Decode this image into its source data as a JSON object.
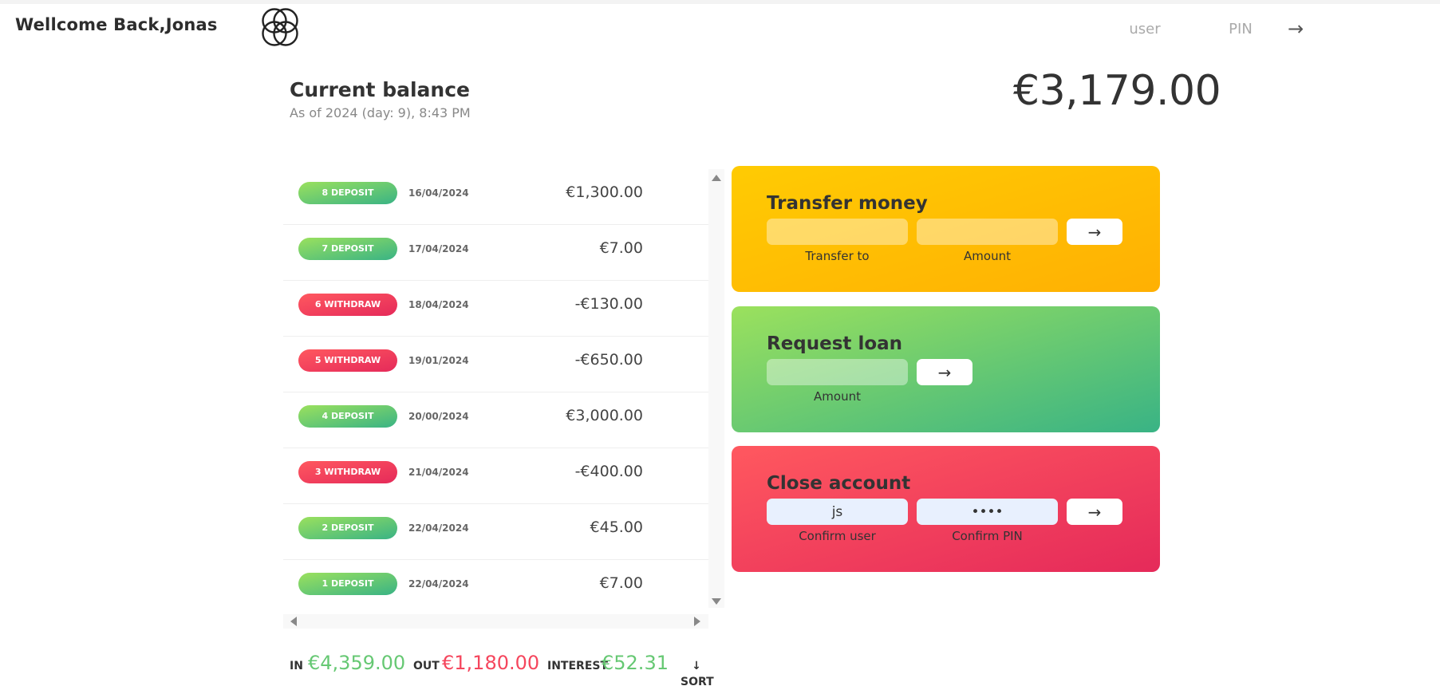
{
  "nav": {
    "welcome": "Wellcome Back,Jonas",
    "user_placeholder": "user",
    "pin_placeholder": "PIN",
    "login_arrow": "→"
  },
  "balance": {
    "label": "Current balance",
    "date": "As of 2024 (day: 9), 8:43 PM",
    "value": "€3,179.00"
  },
  "movements": [
    {
      "type_label": "8 DEPOSIT",
      "kind": "deposit",
      "date": "16/04/2024",
      "value": "€1,300.00"
    },
    {
      "type_label": "7 DEPOSIT",
      "kind": "deposit",
      "date": "17/04/2024",
      "value": "€7.00"
    },
    {
      "type_label": "6 WITHDRAW",
      "kind": "withdrawal",
      "date": "18/04/2024",
      "value": "-€130.00"
    },
    {
      "type_label": "5 WITHDRAW",
      "kind": "withdrawal",
      "date": "19/01/2024",
      "value": "-€650.00"
    },
    {
      "type_label": "4 DEPOSIT",
      "kind": "deposit",
      "date": "20/00/2024",
      "value": "€3,000.00"
    },
    {
      "type_label": "3 WITHDRAW",
      "kind": "withdrawal",
      "date": "21/04/2024",
      "value": "-€400.00"
    },
    {
      "type_label": "2 DEPOSIT",
      "kind": "deposit",
      "date": "22/04/2024",
      "value": "€45.00"
    },
    {
      "type_label": "1 DEPOSIT",
      "kind": "deposit",
      "date": "22/04/2024",
      "value": "€7.00"
    }
  ],
  "summary": {
    "in_label": "In",
    "in_value": "€4,359.00",
    "out_label": "Out",
    "out_value": "€1,180.00",
    "interest_label": "Interest",
    "interest_value": "€52.31",
    "sort_arrow": "↓",
    "sort_label": "SORT"
  },
  "transfer": {
    "title": "Transfer money",
    "to_label": "Transfer to",
    "amount_label": "Amount",
    "to_value": "",
    "amount_value": "",
    "button": "→"
  },
  "loan": {
    "title": "Request loan",
    "amount_label": "Amount",
    "amount_value": "",
    "button": "→"
  },
  "close": {
    "title": "Close account",
    "user_label": "Confirm user",
    "pin_label": "Confirm PIN",
    "user_value": "js",
    "pin_value": "••••",
    "button": "→"
  },
  "colors": {
    "deposit_gradient": [
      "#39b385",
      "#9be15d"
    ],
    "withdrawal_gradient": [
      "#e52a5a",
      "#ff585f"
    ],
    "transfer_gradient": [
      "#ffb003",
      "#ffcb03"
    ],
    "in_color": "#66c873",
    "out_color": "#f5465d"
  }
}
